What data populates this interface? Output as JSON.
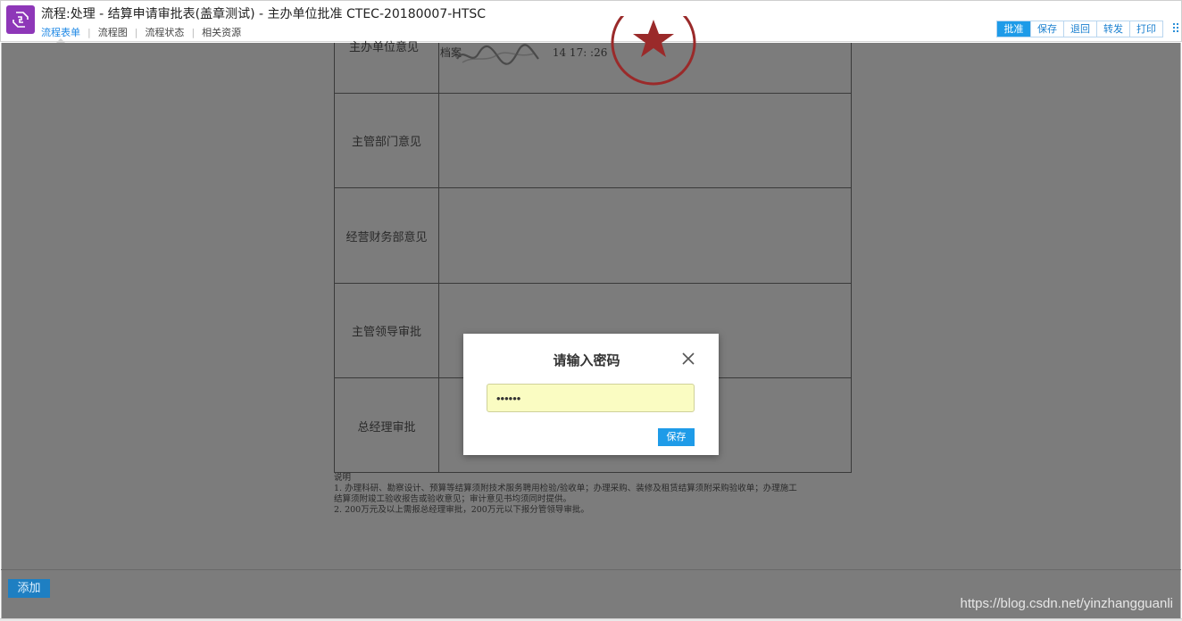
{
  "header": {
    "title": "流程:处理 - 结算申请审批表(盖章测试) - 主办单位批准 CTEC-20180007-HTSC",
    "subnav": [
      {
        "label": "流程表单",
        "active": true
      },
      {
        "label": "流程图",
        "active": false
      },
      {
        "label": "流程状态",
        "active": false
      },
      {
        "label": "相关资源",
        "active": false
      }
    ],
    "toolbar": {
      "approve": "批准",
      "save": "保存",
      "return": "退回",
      "forward": "转发",
      "print": "打印"
    },
    "brand_color": "#8e37b8",
    "accent_color": "#1e9be8"
  },
  "form": {
    "rows": [
      {
        "label": "主办单位意见",
        "signature_text": "档案",
        "sign_date": "14  17:  :26"
      },
      {
        "label": "主管部门意见"
      },
      {
        "label": "经营财务部意见"
      },
      {
        "label": "主管领导审批"
      },
      {
        "label": "总经理审批"
      }
    ],
    "notes": {
      "heading": "说明",
      "line1": "1. 办理科研、勘察设计、预算等结算须附技术服务聘用检验/验收单；办理采购、装修及租赁结算须附采购验收单；办理施工",
      "line2": "结算须附竣工验收报告或验收意见；审计意见书均须同时提供。",
      "line3": "2. 200万元及以上需报总经理审批，200万元以下报分管领导审批。"
    }
  },
  "dialog": {
    "title": "请输入密码",
    "password_value": "••••••",
    "save_label": "保存",
    "close_icon": "close-icon"
  },
  "footer": {
    "add_label": "添加",
    "watermark": "https://blog.csdn.net/yinzhangguanli"
  }
}
